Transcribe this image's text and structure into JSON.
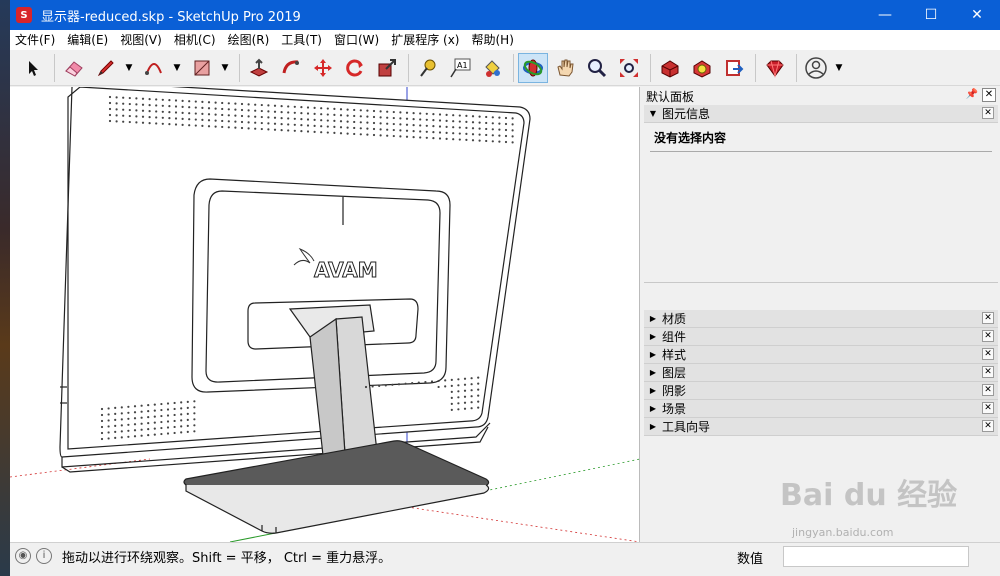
{
  "window": {
    "title": "显示器-reduced.skp - SketchUp Pro 2019",
    "app_icon_glyph": "S",
    "minimize_glyph": "—",
    "maximize_glyph": "☐",
    "close_glyph": "✕"
  },
  "menu": {
    "items": [
      "文件(F)",
      "编辑(E)",
      "视图(V)",
      "相机(C)",
      "绘图(R)",
      "工具(T)",
      "窗口(W)",
      "扩展程序 (x)",
      "帮助(H)"
    ]
  },
  "toolbar": {
    "tools": [
      {
        "icon": "select-arrow-icon"
      },
      {
        "icon": "eraser-icon"
      },
      {
        "icon": "pencil-line-icon"
      },
      {
        "icon": "arc-icon"
      },
      {
        "icon": "rectangle-icon"
      },
      {
        "icon": "push-pull-icon"
      },
      {
        "icon": "follow-me-icon"
      },
      {
        "icon": "move-icon"
      },
      {
        "icon": "rotate-icon"
      },
      {
        "icon": "scale-icon"
      },
      {
        "icon": "tape-measure-icon"
      },
      {
        "icon": "text-icon"
      },
      {
        "icon": "paint-bucket-icon"
      },
      {
        "icon": "orbit-icon",
        "active": true
      },
      {
        "icon": "pan-hand-icon"
      },
      {
        "icon": "zoom-icon"
      },
      {
        "icon": "zoom-extents-icon"
      },
      {
        "icon": "warehouse-icon"
      },
      {
        "icon": "extension-warehouse-icon"
      },
      {
        "icon": "send-to-layout-icon"
      },
      {
        "icon": "ruby-icon"
      },
      {
        "icon": "account-icon"
      }
    ],
    "text_tool_label": "A1",
    "accent": "#cce4f7"
  },
  "tray": {
    "title": "默认面板",
    "entity_info": {
      "label": "图元信息",
      "message": "没有选择内容"
    },
    "collapsed": [
      "材质",
      "组件",
      "样式",
      "图层",
      "阴影",
      "场景",
      "工具向导"
    ]
  },
  "model": {
    "logo_text": "AVAM"
  },
  "status": {
    "hint": "拖动以进行环绕观察。Shift = 平移， Ctrl = 重力悬浮。",
    "measure_label": "数值",
    "measure_value": ""
  },
  "watermark": {
    "text": "Bai du 经验",
    "sub": "jingyan.baidu.com"
  },
  "colors": {
    "titlebar": "#0a5fd6",
    "axis_red": "#d23030",
    "axis_green": "#2a9a2a",
    "axis_blue": "#3344cc"
  }
}
